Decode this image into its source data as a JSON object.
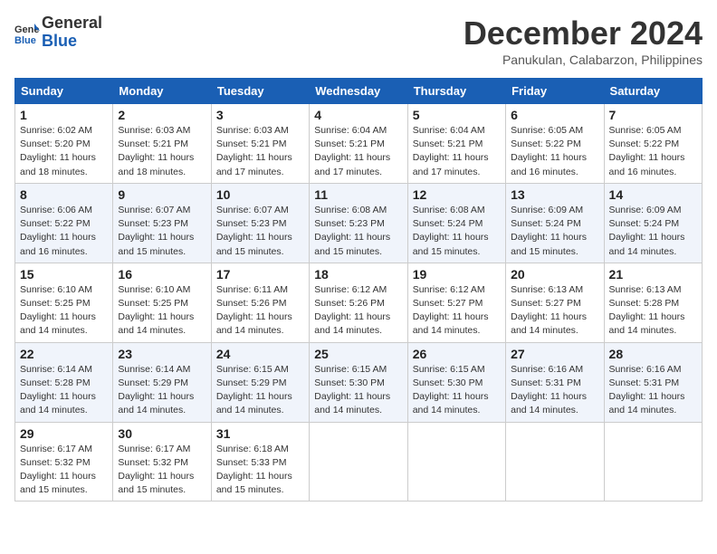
{
  "logo": {
    "line1": "General",
    "line2": "Blue"
  },
  "title": "December 2024",
  "subtitle": "Panukulan, Calabarzon, Philippines",
  "headers": [
    "Sunday",
    "Monday",
    "Tuesday",
    "Wednesday",
    "Thursday",
    "Friday",
    "Saturday"
  ],
  "weeks": [
    [
      {
        "day": "1",
        "sunrise": "Sunrise: 6:02 AM",
        "sunset": "Sunset: 5:20 PM",
        "daylight": "Daylight: 11 hours and 18 minutes."
      },
      {
        "day": "2",
        "sunrise": "Sunrise: 6:03 AM",
        "sunset": "Sunset: 5:21 PM",
        "daylight": "Daylight: 11 hours and 18 minutes."
      },
      {
        "day": "3",
        "sunrise": "Sunrise: 6:03 AM",
        "sunset": "Sunset: 5:21 PM",
        "daylight": "Daylight: 11 hours and 17 minutes."
      },
      {
        "day": "4",
        "sunrise": "Sunrise: 6:04 AM",
        "sunset": "Sunset: 5:21 PM",
        "daylight": "Daylight: 11 hours and 17 minutes."
      },
      {
        "day": "5",
        "sunrise": "Sunrise: 6:04 AM",
        "sunset": "Sunset: 5:21 PM",
        "daylight": "Daylight: 11 hours and 17 minutes."
      },
      {
        "day": "6",
        "sunrise": "Sunrise: 6:05 AM",
        "sunset": "Sunset: 5:22 PM",
        "daylight": "Daylight: 11 hours and 16 minutes."
      },
      {
        "day": "7",
        "sunrise": "Sunrise: 6:05 AM",
        "sunset": "Sunset: 5:22 PM",
        "daylight": "Daylight: 11 hours and 16 minutes."
      }
    ],
    [
      {
        "day": "8",
        "sunrise": "Sunrise: 6:06 AM",
        "sunset": "Sunset: 5:22 PM",
        "daylight": "Daylight: 11 hours and 16 minutes."
      },
      {
        "day": "9",
        "sunrise": "Sunrise: 6:07 AM",
        "sunset": "Sunset: 5:23 PM",
        "daylight": "Daylight: 11 hours and 15 minutes."
      },
      {
        "day": "10",
        "sunrise": "Sunrise: 6:07 AM",
        "sunset": "Sunset: 5:23 PM",
        "daylight": "Daylight: 11 hours and 15 minutes."
      },
      {
        "day": "11",
        "sunrise": "Sunrise: 6:08 AM",
        "sunset": "Sunset: 5:23 PM",
        "daylight": "Daylight: 11 hours and 15 minutes."
      },
      {
        "day": "12",
        "sunrise": "Sunrise: 6:08 AM",
        "sunset": "Sunset: 5:24 PM",
        "daylight": "Daylight: 11 hours and 15 minutes."
      },
      {
        "day": "13",
        "sunrise": "Sunrise: 6:09 AM",
        "sunset": "Sunset: 5:24 PM",
        "daylight": "Daylight: 11 hours and 15 minutes."
      },
      {
        "day": "14",
        "sunrise": "Sunrise: 6:09 AM",
        "sunset": "Sunset: 5:24 PM",
        "daylight": "Daylight: 11 hours and 14 minutes."
      }
    ],
    [
      {
        "day": "15",
        "sunrise": "Sunrise: 6:10 AM",
        "sunset": "Sunset: 5:25 PM",
        "daylight": "Daylight: 11 hours and 14 minutes."
      },
      {
        "day": "16",
        "sunrise": "Sunrise: 6:10 AM",
        "sunset": "Sunset: 5:25 PM",
        "daylight": "Daylight: 11 hours and 14 minutes."
      },
      {
        "day": "17",
        "sunrise": "Sunrise: 6:11 AM",
        "sunset": "Sunset: 5:26 PM",
        "daylight": "Daylight: 11 hours and 14 minutes."
      },
      {
        "day": "18",
        "sunrise": "Sunrise: 6:12 AM",
        "sunset": "Sunset: 5:26 PM",
        "daylight": "Daylight: 11 hours and 14 minutes."
      },
      {
        "day": "19",
        "sunrise": "Sunrise: 6:12 AM",
        "sunset": "Sunset: 5:27 PM",
        "daylight": "Daylight: 11 hours and 14 minutes."
      },
      {
        "day": "20",
        "sunrise": "Sunrise: 6:13 AM",
        "sunset": "Sunset: 5:27 PM",
        "daylight": "Daylight: 11 hours and 14 minutes."
      },
      {
        "day": "21",
        "sunrise": "Sunrise: 6:13 AM",
        "sunset": "Sunset: 5:28 PM",
        "daylight": "Daylight: 11 hours and 14 minutes."
      }
    ],
    [
      {
        "day": "22",
        "sunrise": "Sunrise: 6:14 AM",
        "sunset": "Sunset: 5:28 PM",
        "daylight": "Daylight: 11 hours and 14 minutes."
      },
      {
        "day": "23",
        "sunrise": "Sunrise: 6:14 AM",
        "sunset": "Sunset: 5:29 PM",
        "daylight": "Daylight: 11 hours and 14 minutes."
      },
      {
        "day": "24",
        "sunrise": "Sunrise: 6:15 AM",
        "sunset": "Sunset: 5:29 PM",
        "daylight": "Daylight: 11 hours and 14 minutes."
      },
      {
        "day": "25",
        "sunrise": "Sunrise: 6:15 AM",
        "sunset": "Sunset: 5:30 PM",
        "daylight": "Daylight: 11 hours and 14 minutes."
      },
      {
        "day": "26",
        "sunrise": "Sunrise: 6:15 AM",
        "sunset": "Sunset: 5:30 PM",
        "daylight": "Daylight: 11 hours and 14 minutes."
      },
      {
        "day": "27",
        "sunrise": "Sunrise: 6:16 AM",
        "sunset": "Sunset: 5:31 PM",
        "daylight": "Daylight: 11 hours and 14 minutes."
      },
      {
        "day": "28",
        "sunrise": "Sunrise: 6:16 AM",
        "sunset": "Sunset: 5:31 PM",
        "daylight": "Daylight: 11 hours and 14 minutes."
      }
    ],
    [
      {
        "day": "29",
        "sunrise": "Sunrise: 6:17 AM",
        "sunset": "Sunset: 5:32 PM",
        "daylight": "Daylight: 11 hours and 15 minutes."
      },
      {
        "day": "30",
        "sunrise": "Sunrise: 6:17 AM",
        "sunset": "Sunset: 5:32 PM",
        "daylight": "Daylight: 11 hours and 15 minutes."
      },
      {
        "day": "31",
        "sunrise": "Sunrise: 6:18 AM",
        "sunset": "Sunset: 5:33 PM",
        "daylight": "Daylight: 11 hours and 15 minutes."
      },
      null,
      null,
      null,
      null
    ]
  ]
}
